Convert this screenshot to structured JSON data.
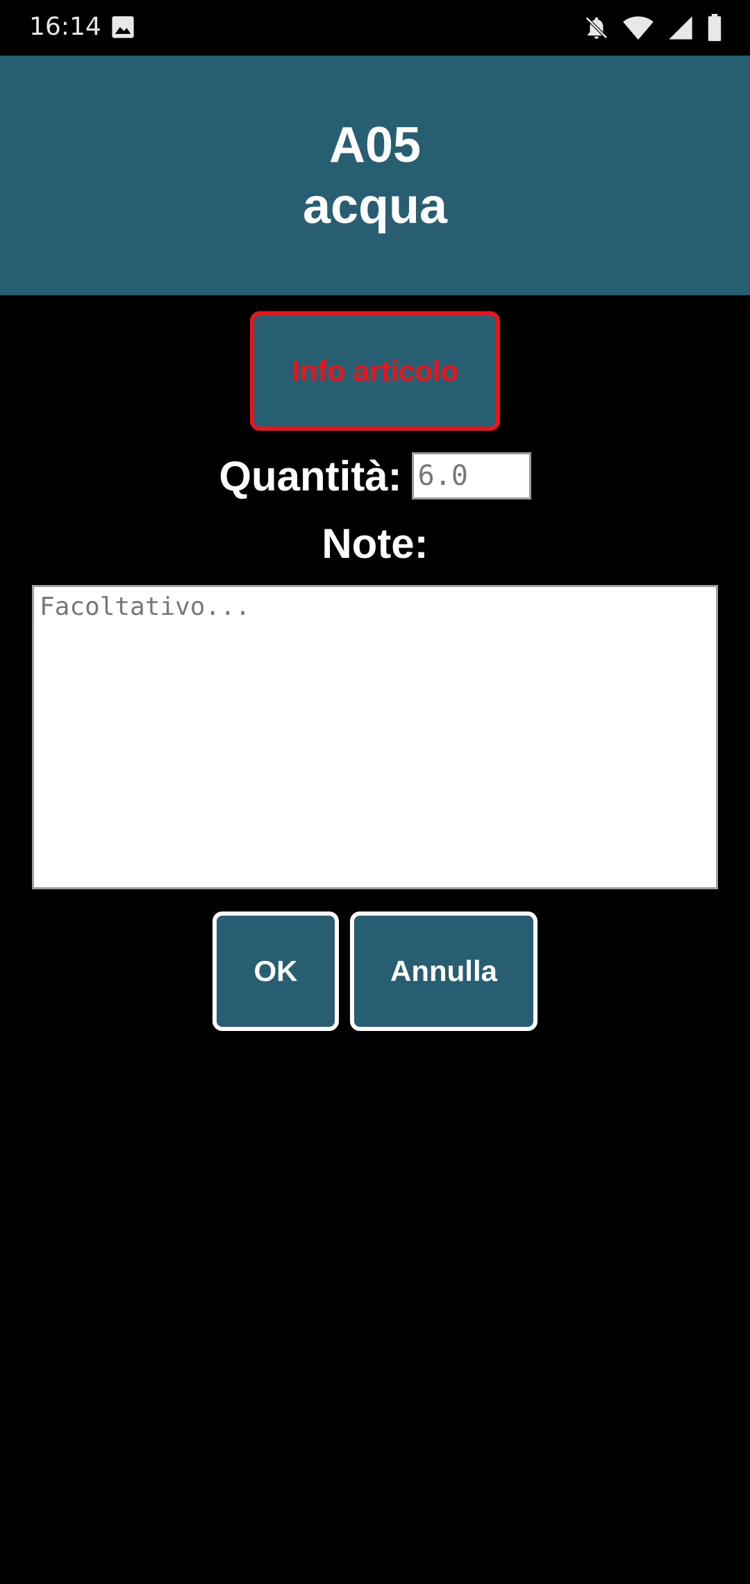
{
  "status_bar": {
    "time": "16:14",
    "icons": [
      "image-icon",
      "notifications-off-icon",
      "wifi-icon",
      "signal-icon",
      "battery-icon"
    ]
  },
  "header": {
    "code": "A05",
    "name": "acqua",
    "background_color": "#285e72"
  },
  "info_button": {
    "label": "Info articolo",
    "text_color": "#e8151b",
    "border_color": "#e8151b"
  },
  "quantity": {
    "label": "Quantità:",
    "placeholder": "6.0"
  },
  "notes": {
    "label": "Note:",
    "placeholder": "Facoltativo..."
  },
  "actions": {
    "ok_label": "OK",
    "cancel_label": "Annulla"
  }
}
